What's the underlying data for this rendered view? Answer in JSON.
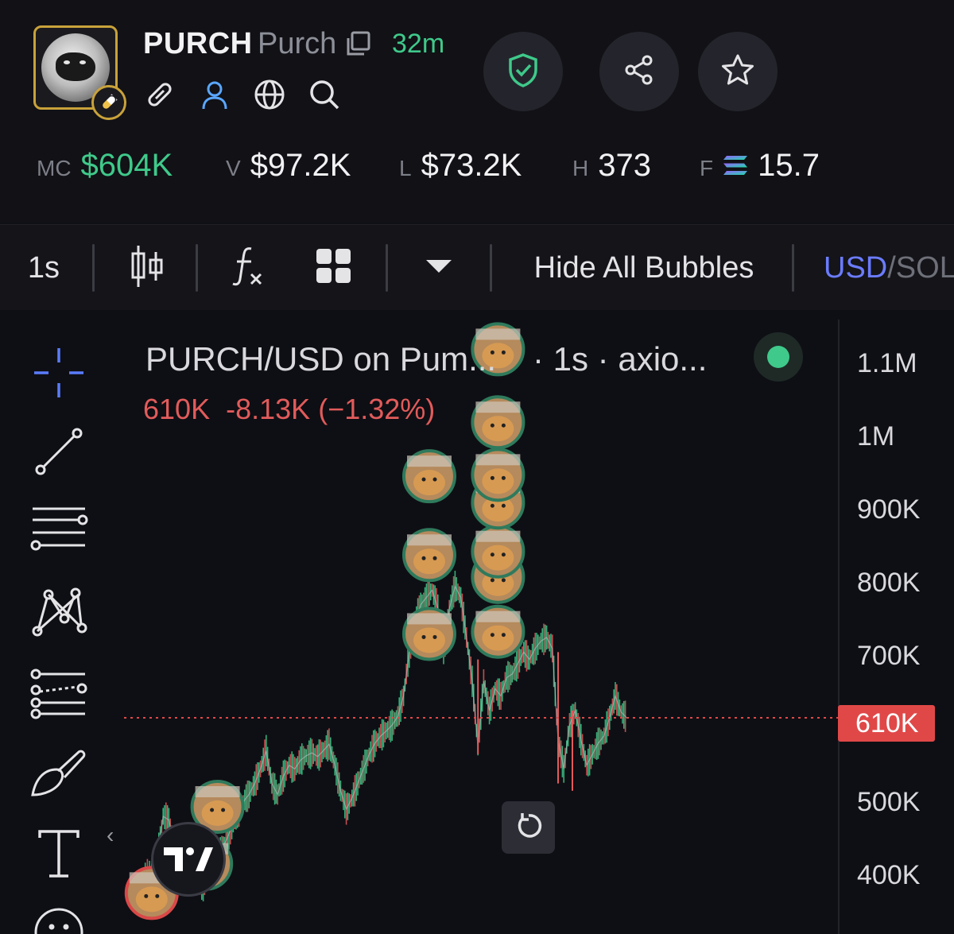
{
  "token": {
    "symbol": "PURCH",
    "name": "Purch",
    "age": "32m"
  },
  "stats": [
    {
      "key": "MC",
      "value": "$604K",
      "color": "#3fc98a"
    },
    {
      "key": "V",
      "value": "$97.2K"
    },
    {
      "key": "L",
      "value": "$73.2K"
    },
    {
      "key": "H",
      "value": "373"
    },
    {
      "key": "F",
      "value": "15.7",
      "icon": "solana-icon"
    }
  ],
  "header_icons": [
    "link-icon",
    "user-icon",
    "globe-icon",
    "search-icon"
  ],
  "header_buttons": [
    "shield-check-icon",
    "share-icon",
    "star-icon"
  ],
  "toolbar": {
    "interval": "1s",
    "hide_bubbles": "Hide All Bubbles",
    "currency_active": "USD",
    "currency_separator": "/",
    "currency_inactive": "SOL"
  },
  "legend": {
    "title": "PURCH/USD on Pum...",
    "subtitle": "· 1s · axio...",
    "last": "610K",
    "change": "-8.13K",
    "change_pct": "(−1.32%)"
  },
  "price_axis": {
    "labels": [
      "1.1M",
      "1M",
      "900K",
      "800K",
      "700K",
      "500K",
      "400K"
    ],
    "current": "610K"
  },
  "drawing_tools": [
    "crosshair-icon",
    "trendline-icon",
    "horizontal-lines-icon",
    "pattern-icon",
    "prediction-icon",
    "brush-icon",
    "text-icon",
    "emoji-icon"
  ],
  "chart_data": {
    "type": "line",
    "interval": "1s",
    "y_unit": "USD market cap",
    "ylim": [
      360000,
      1180000
    ],
    "last_value": 610000,
    "points": [
      [
        0,
        390000
      ],
      [
        6,
        400000
      ],
      [
        10,
        420000
      ],
      [
        14,
        475000
      ],
      [
        18,
        470000
      ],
      [
        22,
        432000
      ],
      [
        26,
        400000
      ],
      [
        30,
        385000
      ],
      [
        34,
        395000
      ],
      [
        38,
        388000
      ],
      [
        42,
        380000
      ],
      [
        46,
        395000
      ],
      [
        50,
        410000
      ],
      [
        54,
        425000
      ],
      [
        58,
        442000
      ],
      [
        62,
        460000
      ],
      [
        66,
        478000
      ],
      [
        70,
        495000
      ],
      [
        74,
        505000
      ],
      [
        78,
        520000
      ],
      [
        82,
        540000
      ],
      [
        86,
        565000
      ],
      [
        90,
        520000
      ],
      [
        94,
        505000
      ],
      [
        98,
        530000
      ],
      [
        102,
        545000
      ],
      [
        106,
        540000
      ],
      [
        110,
        552000
      ],
      [
        114,
        558000
      ],
      [
        118,
        562000
      ],
      [
        122,
        557000
      ],
      [
        126,
        565000
      ],
      [
        130,
        574000
      ],
      [
        134,
        545000
      ],
      [
        138,
        510000
      ],
      [
        142,
        485000
      ],
      [
        146,
        500000
      ],
      [
        150,
        520000
      ],
      [
        154,
        540000
      ],
      [
        158,
        560000
      ],
      [
        162,
        575000
      ],
      [
        166,
        585000
      ],
      [
        170,
        592000
      ],
      [
        174,
        600000
      ],
      [
        178,
        612000
      ],
      [
        182,
        640000
      ],
      [
        186,
        700000
      ],
      [
        190,
        740000
      ],
      [
        194,
        765000
      ],
      [
        198,
        775000
      ],
      [
        202,
        785000
      ],
      [
        206,
        760000
      ],
      [
        210,
        700000
      ],
      [
        214,
        760000
      ],
      [
        218,
        790000
      ],
      [
        222,
        775000
      ],
      [
        226,
        720000
      ],
      [
        230,
        660000
      ],
      [
        234,
        570000
      ],
      [
        238,
        660000
      ],
      [
        242,
        620000
      ],
      [
        246,
        650000
      ],
      [
        250,
        640000
      ],
      [
        254,
        665000
      ],
      [
        258,
        670000
      ],
      [
        262,
        685000
      ],
      [
        266,
        700000
      ],
      [
        270,
        690000
      ],
      [
        274,
        705000
      ],
      [
        278,
        715000
      ],
      [
        282,
        720000
      ],
      [
        286,
        705000
      ],
      [
        290,
        580000
      ],
      [
        294,
        540000
      ],
      [
        298,
        600000
      ],
      [
        302,
        620000
      ],
      [
        306,
        580000
      ],
      [
        310,
        545000
      ],
      [
        314,
        560000
      ],
      [
        318,
        575000
      ],
      [
        322,
        585000
      ],
      [
        326,
        610000
      ],
      [
        330,
        640000
      ],
      [
        334,
        618000
      ],
      [
        338,
        610000
      ]
    ],
    "bubbles": [
      {
        "x": 6,
        "y": 370000,
        "border": "#d94848"
      },
      {
        "x": 44,
        "y": 410000,
        "border": "#2f7a5c"
      },
      {
        "x": 52,
        "y": 488000,
        "border": "#2f7a5c"
      },
      {
        "x": 200,
        "y": 725000,
        "border": "#2f7a5c"
      },
      {
        "x": 200,
        "y": 833000,
        "border": "#2f7a5c"
      },
      {
        "x": 200,
        "y": 941000,
        "border": "#2f7a5c"
      },
      {
        "x": 248,
        "y": 728000,
        "border": "#2f7a5c"
      },
      {
        "x": 248,
        "y": 803000,
        "border": "#2f7a5c"
      },
      {
        "x": 248,
        "y": 838000,
        "border": "#2f7a5c"
      },
      {
        "x": 248,
        "y": 905000,
        "border": "#2f7a5c"
      },
      {
        "x": 248,
        "y": 943000,
        "border": "#2f7a5c"
      },
      {
        "x": 248,
        "y": 1015000,
        "border": "#2f7a5c"
      },
      {
        "x": 248,
        "y": 1115000,
        "border": "#2f7a5c"
      }
    ]
  },
  "colors": {
    "up": "#3fc98a",
    "down": "#e25b5b",
    "accent": "#6b7cff",
    "gold": "#c9a23a"
  }
}
